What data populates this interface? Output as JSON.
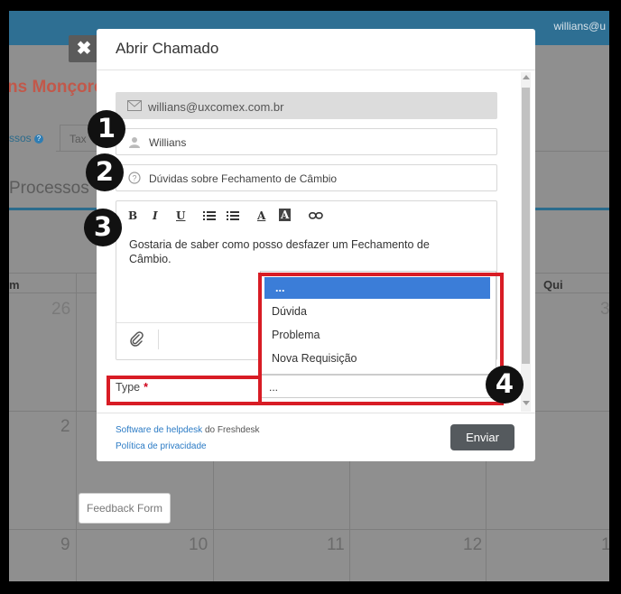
{
  "background": {
    "user": "willians@u",
    "company": "ns Monçore",
    "tab_active": "ssos",
    "tab_active_badge": "?",
    "tab_second": "Tax",
    "section_title": "Processos",
    "day_left": "m",
    "day_right": "Qui",
    "numbers": {
      "n26": "26",
      "n3": "3",
      "n2": "2",
      "n9": "9",
      "n10": "10",
      "n11": "11",
      "n12": "12",
      "n1": "1"
    },
    "feedback_label": "Feedback Form",
    "close_glyph": "✖"
  },
  "modal": {
    "title": "Abrir Chamado",
    "email_value": "willians@uxcomex.com.br",
    "name_value": "Willians",
    "subject_value": "Dúvidas sobre Fechamento de Câmbio",
    "toolbar": {
      "bold": "B",
      "italic": "I",
      "underline": "U",
      "font_color": "A",
      "bg_color": "A"
    },
    "description": "Gostaria de saber como posso desfazer um Fechamento de Câmbio.",
    "type_label": "Type",
    "type_required": "*",
    "type_value": "...",
    "type_options": [
      "...",
      "Dúvida",
      "Problema",
      "Nova Requisição"
    ],
    "footer_link1": "Software de helpdesk",
    "footer_text1": " do Freshdesk",
    "footer_link2": "Política de privacidade",
    "send_label": "Enviar"
  },
  "annotations": [
    "1",
    "2",
    "3",
    "4"
  ],
  "colors": {
    "annotation_red": "#d81c25",
    "dropdown_selected": "#3b7dd8",
    "send_button": "#555a5e"
  }
}
